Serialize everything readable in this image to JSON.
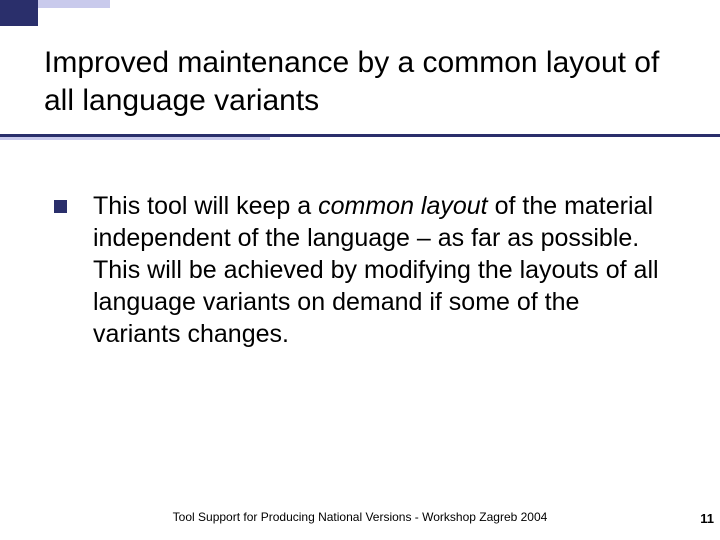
{
  "title": "Improved maintenance by a common layout of all language variants",
  "bullet": {
    "pre": "This tool will keep a ",
    "emph": "common layout",
    "post": " of the material independent of the language – as far as possible. This will be achieved by modifying the layouts of all language variants on demand if some of the variants changes."
  },
  "footer": "Tool Support for Producing National Versions - Workshop Zagreb 2004",
  "page_number": "11",
  "colors": {
    "accent_dark": "#2a2f6b",
    "accent_light": "#c9caec"
  }
}
